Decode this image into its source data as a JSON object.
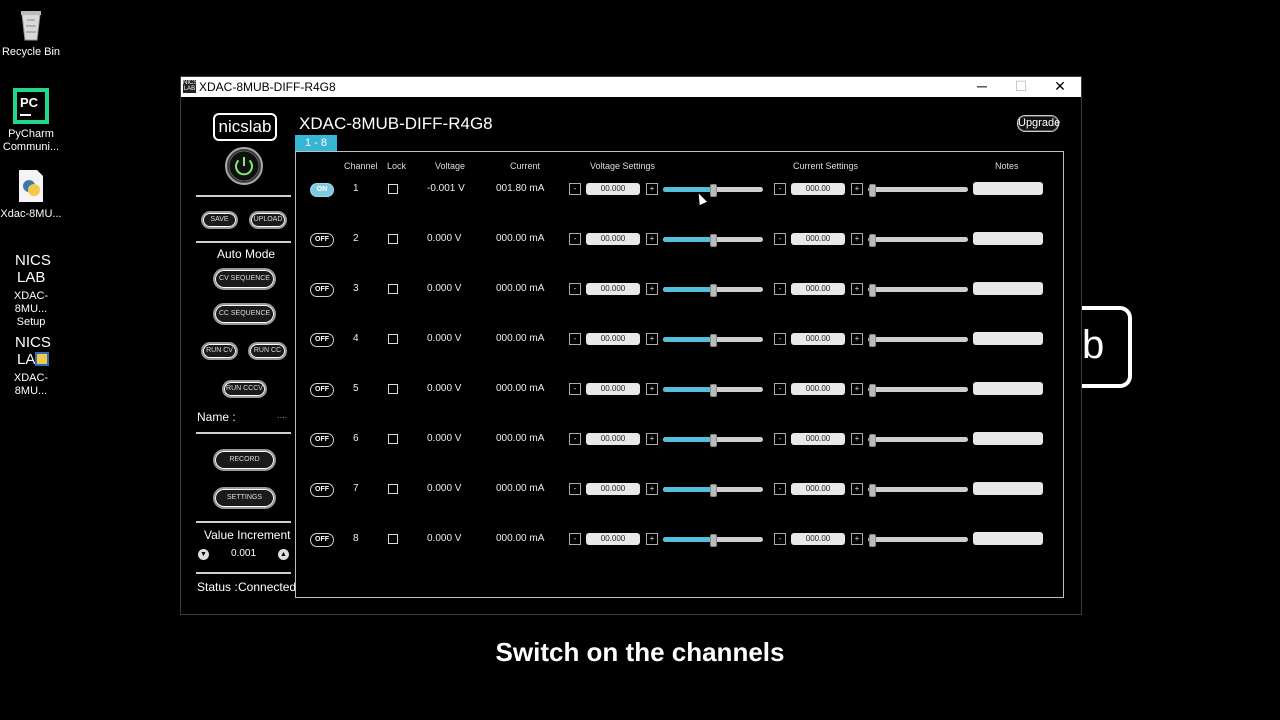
{
  "desktop": {
    "icons": [
      {
        "label": "Recycle Bin"
      },
      {
        "label": "PyCharm Communi..."
      },
      {
        "label": "Xdac-8MU..."
      },
      {
        "label": "XDAC-8MU... Setup"
      },
      {
        "label": "XDAC-8MU..."
      }
    ]
  },
  "window": {
    "title": "XDAC-8MUB-DIFF-R4G8",
    "icon_text": "NICS LAB",
    "minimize": "─",
    "maximize": "☐",
    "close": "✕"
  },
  "sidebar": {
    "logo": "nicslab",
    "save": "SAVE",
    "upload": "UPLOAD",
    "auto_mode": "Auto Mode",
    "cv_sequence": "CV SEQUENCE",
    "cc_sequence": "CC SEQUENCE",
    "run_cv": "RUN CV",
    "run_cc": "RUN CC",
    "run_cccv": "RUN CCCV",
    "name_label": "Name :",
    "name_value": "....",
    "record": "RECORD",
    "settings": "SETTINGS",
    "value_increment": "Value Increment",
    "increment_value": "0.001",
    "status_label": "Status :",
    "status_value": "Connected"
  },
  "main": {
    "title": "XDAC-8MUB-DIFF-R4G8",
    "tab": "1 - 8",
    "upgrade": "Upgrade",
    "headers": {
      "channel": "Channel",
      "lock": "Lock",
      "voltage": "Voltage",
      "current": "Current",
      "voltage_settings": "Voltage Settings",
      "current_settings": "Current Settings",
      "notes": "Notes"
    },
    "minus": "-",
    "plus": "+",
    "rows": [
      {
        "state": "ON",
        "channel": "1",
        "voltage": "-0.001  V",
        "current": "001.80  mA",
        "v_set": "00.000",
        "i_set": "000.00",
        "v_slider": 0.5,
        "i_slider": 0.0
      },
      {
        "state": "OFF",
        "channel": "2",
        "voltage": "0.000  V",
        "current": "000.00  mA",
        "v_set": "00.000",
        "i_set": "000.00",
        "v_slider": 0.5,
        "i_slider": 0.0
      },
      {
        "state": "OFF",
        "channel": "3",
        "voltage": "0.000  V",
        "current": "000.00  mA",
        "v_set": "00.000",
        "i_set": "000.00",
        "v_slider": 0.5,
        "i_slider": 0.0
      },
      {
        "state": "OFF",
        "channel": "4",
        "voltage": "0.000  V",
        "current": "000.00  mA",
        "v_set": "00.000",
        "i_set": "000.00",
        "v_slider": 0.5,
        "i_slider": 0.0
      },
      {
        "state": "OFF",
        "channel": "5",
        "voltage": "0.000  V",
        "current": "000.00  mA",
        "v_set": "00.000",
        "i_set": "000.00",
        "v_slider": 0.5,
        "i_slider": 0.0
      },
      {
        "state": "OFF",
        "channel": "6",
        "voltage": "0.000  V",
        "current": "000.00  mA",
        "v_set": "00.000",
        "i_set": "000.00",
        "v_slider": 0.5,
        "i_slider": 0.0
      },
      {
        "state": "OFF",
        "channel": "7",
        "voltage": "0.000  V",
        "current": "000.00  mA",
        "v_set": "00.000",
        "i_set": "000.00",
        "v_slider": 0.5,
        "i_slider": 0.0
      },
      {
        "state": "OFF",
        "channel": "8",
        "voltage": "0.000  V",
        "current": "000.00  mA",
        "v_set": "00.000",
        "i_set": "000.00",
        "v_slider": 0.5,
        "i_slider": 0.0
      }
    ]
  },
  "background_text": "b",
  "caption": "Switch on the channels",
  "colors": {
    "accent": "#37b6d3",
    "background": "#000000"
  }
}
